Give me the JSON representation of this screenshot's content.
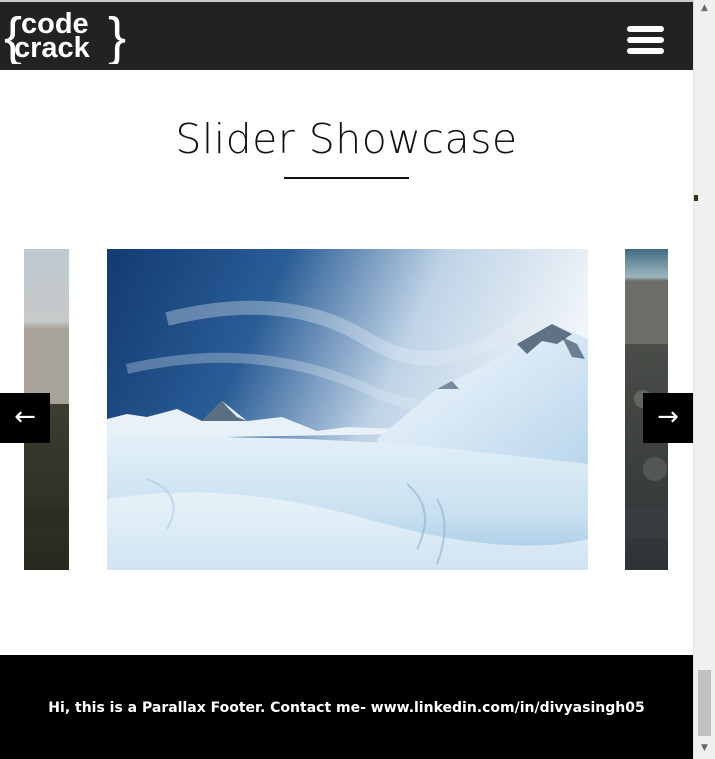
{
  "header": {
    "logo_line1": "code",
    "logo_line2": "crack",
    "menu_icon": "hamburger-menu-icon"
  },
  "main": {
    "title": "Slider Showcase"
  },
  "slider": {
    "prev_arrow": "←",
    "next_arrow": "→",
    "slides": [
      {
        "subject": "sky over dark field"
      },
      {
        "subject": "snowy mountain landscape under blue sky"
      },
      {
        "subject": "dusky valley with rocks"
      }
    ]
  },
  "footer": {
    "text": "Hi, this is a Parallax Footer. Contact me- www.linkedin.com/in/divyasingh05"
  },
  "scrollbar": {
    "up_icon": "▲",
    "down_icon": "▼"
  },
  "colors": {
    "header_bg": "#222222",
    "footer_bg": "#000000",
    "arrow_bg": "#000000"
  }
}
